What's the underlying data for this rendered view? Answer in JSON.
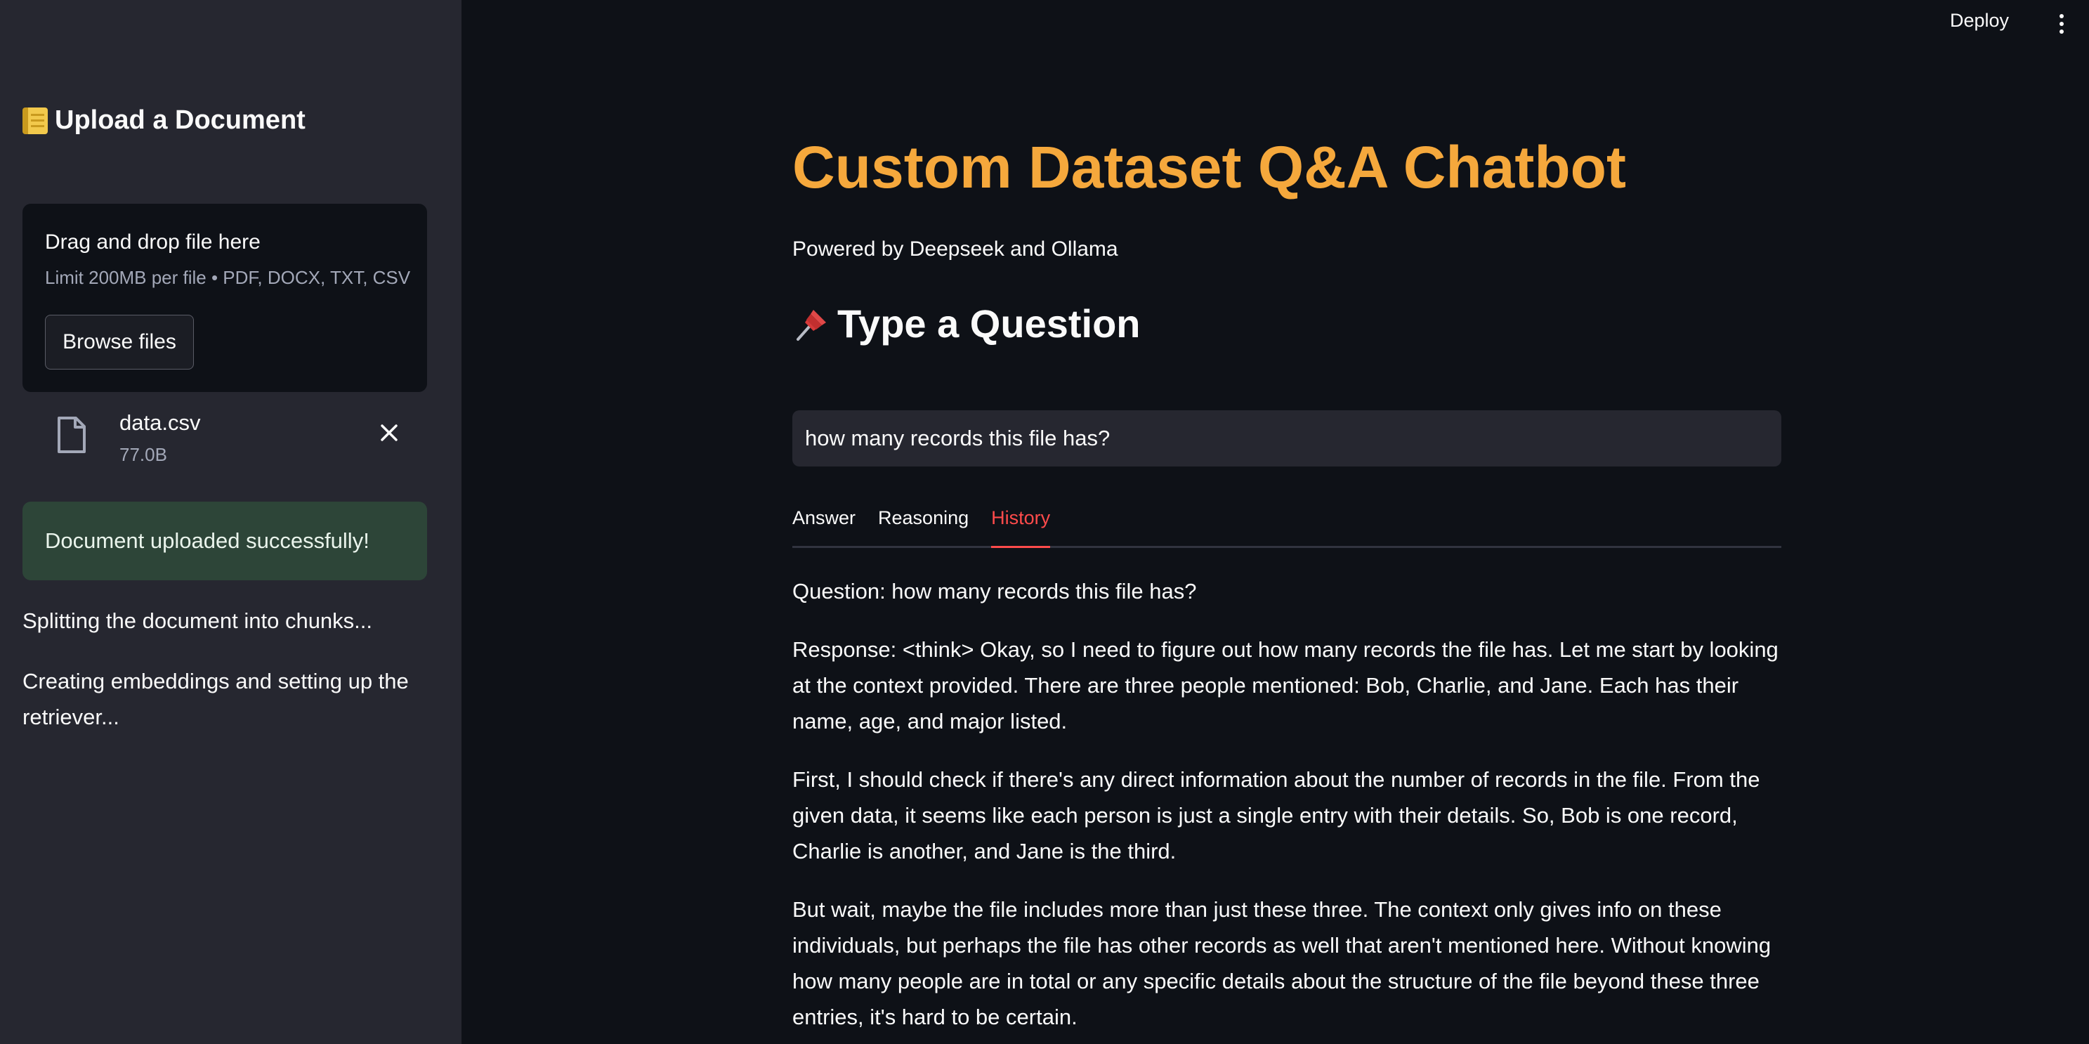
{
  "sidebar": {
    "title": "Upload a Document",
    "uploader": {
      "title": "Drag and drop file here",
      "limit": "Limit 200MB per file • PDF, DOCX, TXT, CSV",
      "browse_label": "Browse files"
    },
    "file": {
      "name": "data.csv",
      "size": "77.0B"
    },
    "success_message": "Document uploaded successfully!",
    "status": [
      "Splitting the document into chunks...",
      "Creating embeddings and setting up the retriever..."
    ]
  },
  "topbar": {
    "deploy_label": "Deploy"
  },
  "main": {
    "title": "Custom Dataset Q&A Chatbot",
    "subtitle": "Powered by Deepseek and Ollama",
    "section_heading": "Type a Question",
    "query_value": "how many records this file has?",
    "tabs": [
      {
        "label": "Answer",
        "active": false
      },
      {
        "label": "Reasoning",
        "active": false
      },
      {
        "label": "History",
        "active": true
      }
    ],
    "history": [
      "Question: how many records this file has?",
      "Response: <think> Okay, so I need to figure out how many records the file has. Let me start by looking at the context provided. There are three people mentioned: Bob, Charlie, and Jane. Each has their name, age, and major listed.",
      "First, I should check if there's any direct information about the number of records in the file. From the given data, it seems like each person is just a single entry with their details. So, Bob is one record, Charlie is another, and Jane is the third.",
      "But wait, maybe the file includes more than just these three. The context only gives info on these individuals, but perhaps the file has other records as well that aren't mentioned here. Without knowing how many people are in total or any specific details about the structure of the file beyond these three entries, it's hard to be certain."
    ]
  },
  "colors": {
    "sidebar_bg": "#262730",
    "main_bg": "#0e1117",
    "title_orange": "#f5a83c",
    "accent_red": "#ff4b4b",
    "success_bg": "#2d4538"
  },
  "icons": [
    "notebook-icon",
    "file-icon",
    "close-icon",
    "pushpin-icon",
    "kebab-menu-icon"
  ]
}
